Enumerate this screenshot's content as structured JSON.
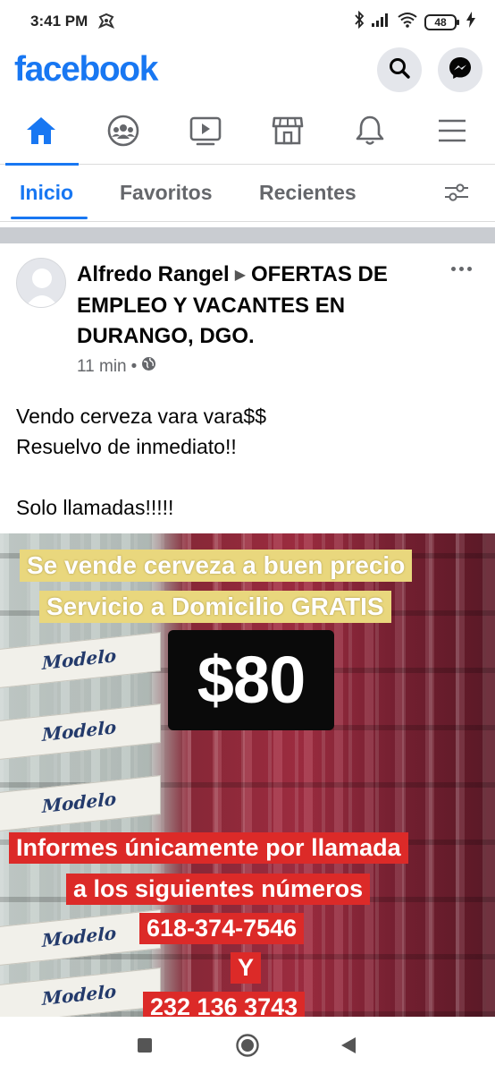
{
  "status_bar": {
    "time": "3:41 PM",
    "battery": "48",
    "battery_level": 0.48,
    "icons": [
      "notification-icon",
      "bluetooth-icon",
      "signal-icon",
      "wifi-icon",
      "battery-icon",
      "charging-icon"
    ]
  },
  "header": {
    "logo": "facebook",
    "brand_color": "#1877f2",
    "actions": [
      "search-icon",
      "messenger-icon"
    ]
  },
  "nav": {
    "items": [
      "home-icon",
      "groups-icon",
      "watch-icon",
      "marketplace-icon",
      "bell-icon",
      "menu-icon"
    ],
    "active": "home"
  },
  "feed_tabs": {
    "items": [
      {
        "label": "Inicio"
      },
      {
        "label": "Favoritos"
      },
      {
        "label": "Recientes"
      }
    ],
    "active": "Inicio"
  },
  "post": {
    "author": "Alfredo Rangel",
    "group": "OFERTAS DE EMPLEO Y VACANTES EN DURANGO, DGO.",
    "time": "11 min",
    "privacy_icon": "globe-icon",
    "body": {
      "line1": "Vendo cerveza vara vara$$",
      "line2": "Resuelvo de inmediato!!",
      "line3": "Solo llamadas!!!!!"
    },
    "image": {
      "line1": "Se vende cerveza a buen precio",
      "line2": "Servicio a Domicilio GRATIS",
      "price": "$80",
      "line3": "Informes únicamente por llamada",
      "line4": "a los siguientes números",
      "phone1": "618-374-7546",
      "connector": "Y",
      "phone2": "232 136 3743",
      "box_brand": "Modelo"
    }
  },
  "system_nav": [
    "recents-icon",
    "home-button-icon",
    "back-icon"
  ]
}
